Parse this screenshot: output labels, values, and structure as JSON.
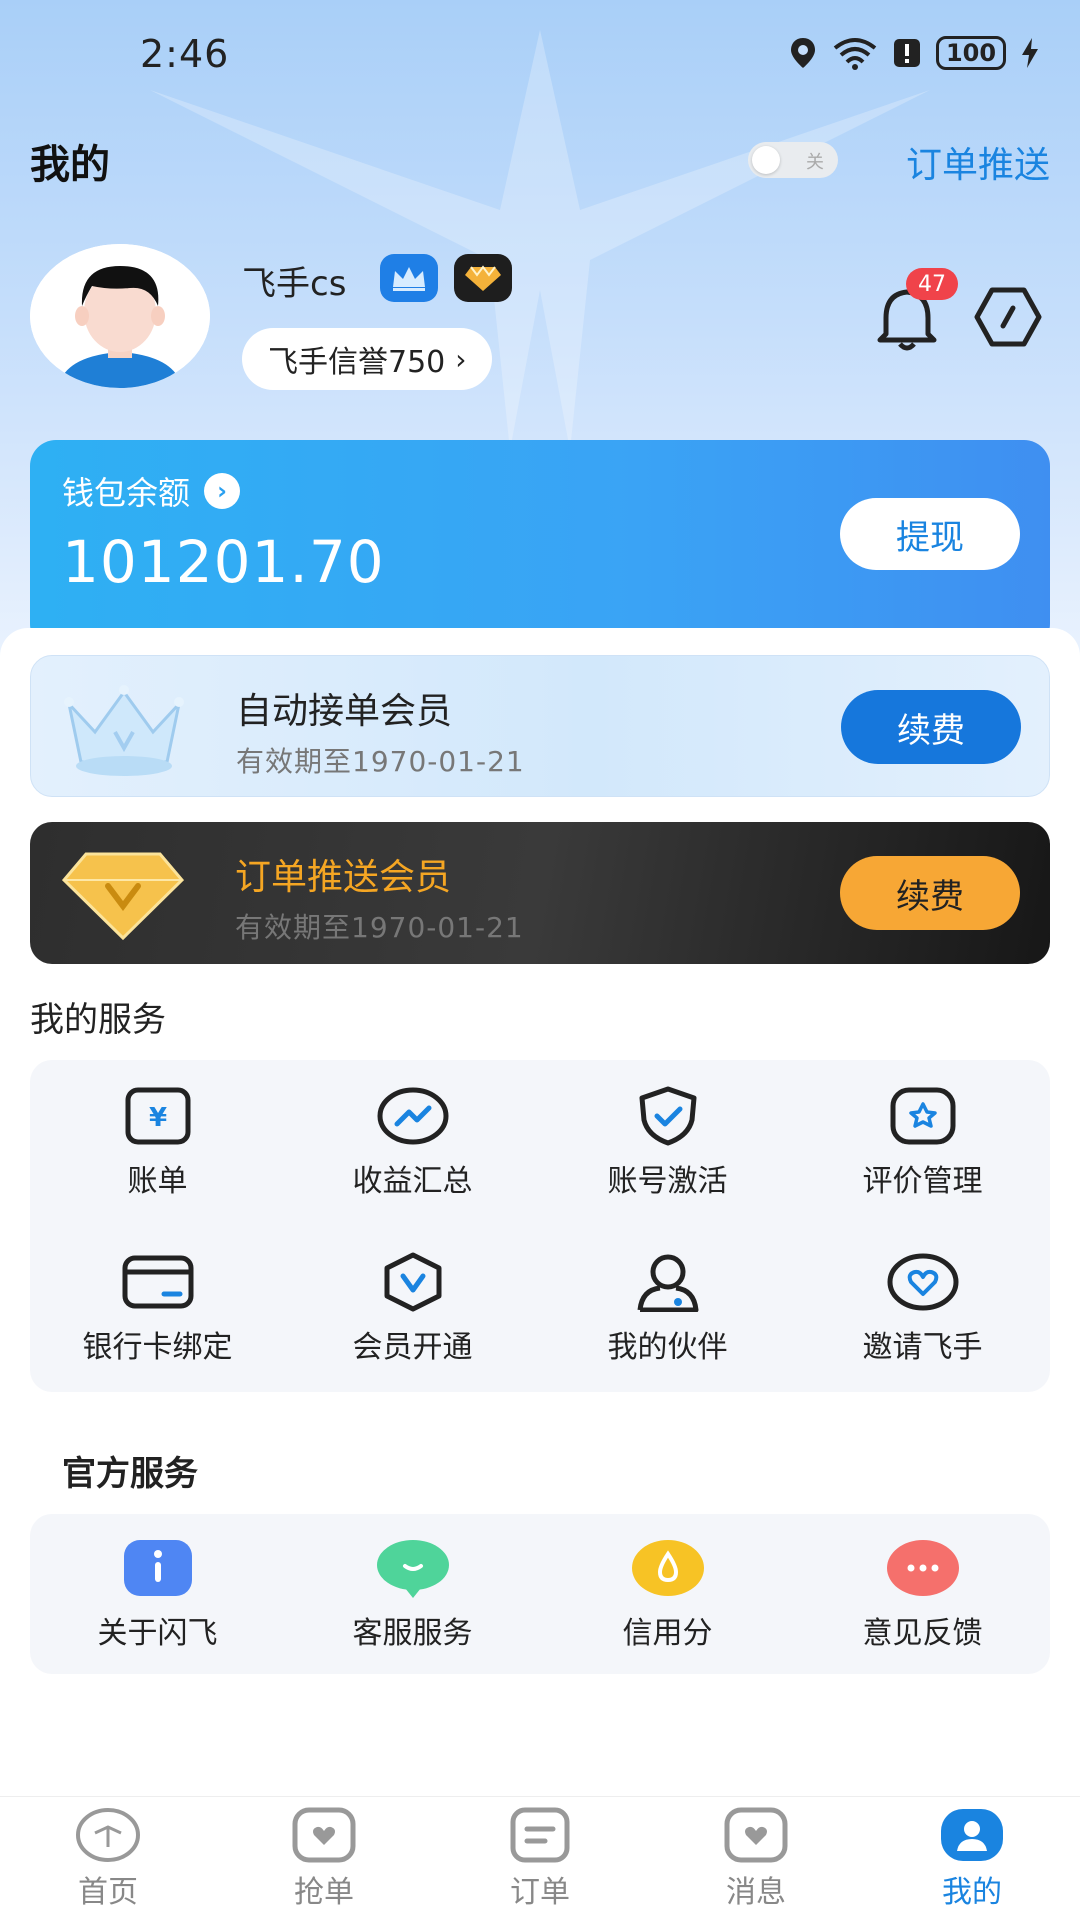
{
  "status_bar": {
    "time": "2:46",
    "battery": "100"
  },
  "header": {
    "title": "我的",
    "toggle_text": "关",
    "push_link": "订单推送"
  },
  "profile": {
    "username": "飞手cs",
    "reputation": "飞手信誉750",
    "notification_count": "47"
  },
  "wallet": {
    "label": "钱包余额",
    "amount": "101201.70",
    "withdraw_label": "提现"
  },
  "memberships": [
    {
      "title": "自动接单会员",
      "expiry": "有效期至1970-01-21",
      "action": "续费"
    },
    {
      "title": "订单推送会员",
      "expiry": "有效期至1970-01-21",
      "action": "续费"
    }
  ],
  "my_services": {
    "title": "我的服务",
    "items": [
      {
        "label": "账单",
        "icon": "bill-icon"
      },
      {
        "label": "收益汇总",
        "icon": "earnings-icon"
      },
      {
        "label": "账号激活",
        "icon": "shield-check-icon"
      },
      {
        "label": "评价管理",
        "icon": "review-icon"
      },
      {
        "label": "银行卡绑定",
        "icon": "bank-card-icon"
      },
      {
        "label": "会员开通",
        "icon": "vip-icon"
      },
      {
        "label": "我的伙伴",
        "icon": "partner-icon"
      },
      {
        "label": "邀请飞手",
        "icon": "invite-icon"
      }
    ]
  },
  "official_services": {
    "title": "官方服务",
    "items": [
      {
        "label": "关于闪飞",
        "icon": "info-icon",
        "color": "#4f86f3"
      },
      {
        "label": "客服服务",
        "icon": "chat-icon",
        "color": "#4fd49a"
      },
      {
        "label": "信用分",
        "icon": "credit-icon",
        "color": "#f7c325"
      },
      {
        "label": "意见反馈",
        "icon": "feedback-icon",
        "color": "#f5706c"
      }
    ]
  },
  "tabbar": {
    "items": [
      {
        "label": "首页",
        "icon": "home-icon"
      },
      {
        "label": "抢单",
        "icon": "grab-order-icon"
      },
      {
        "label": "订单",
        "icon": "order-icon"
      },
      {
        "label": "消息",
        "icon": "message-icon"
      },
      {
        "label": "我的",
        "icon": "profile-icon",
        "active": true
      }
    ]
  },
  "colors": {
    "accent": "#1a84e0",
    "gold": "#f5a623",
    "badge": "#f0434a"
  }
}
